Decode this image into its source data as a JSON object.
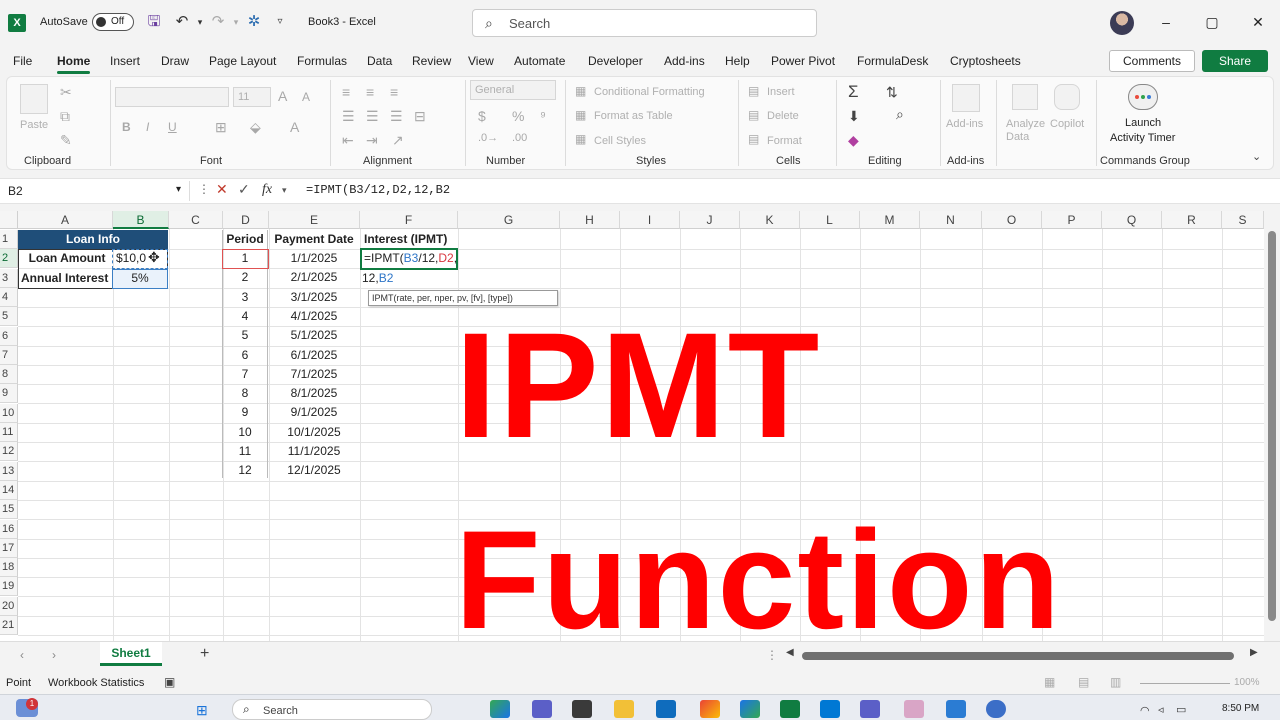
{
  "titlebar": {
    "autosave_label": "AutoSave",
    "toggle_state": "Off",
    "doc_title": "Book3 - Excel",
    "search_placeholder": "Search",
    "minimize": "–",
    "restore": "▢",
    "close": "✕"
  },
  "menu": {
    "items": [
      "File",
      "Home",
      "Insert",
      "Draw",
      "Page Layout",
      "Formulas",
      "Data",
      "Review",
      "View",
      "Automate",
      "Developer",
      "Add-ins",
      "Help",
      "Power Pivot",
      "FormulaDesk",
      "Cryptosheets"
    ],
    "active": "Home",
    "comments_label": "Comments",
    "share_label": "Share"
  },
  "ribbon": {
    "groups": [
      "Clipboard",
      "Font",
      "Alignment",
      "Number",
      "Styles",
      "Cells",
      "Editing",
      "Add-ins",
      "Commands Group"
    ],
    "paste_label": "Paste",
    "font_size": "11",
    "number_format": "General",
    "conditional_formatting": "Conditional Formatting",
    "format_as_table": "Format as Table",
    "cell_styles": "Cell Styles",
    "insert": "Insert",
    "delete": "Delete",
    "format": "Format",
    "add_ins": "Add-ins",
    "analyze_data": "Analyze Data",
    "copilot": "Copilot",
    "launch_timer_1": "Launch",
    "launch_timer_2": "Activity Timer"
  },
  "formula_bar": {
    "name_box": "B2",
    "fx_label": "fx",
    "formula": "=IPMT(B3/12,D2,12,B2"
  },
  "columns": [
    "A",
    "B",
    "C",
    "D",
    "E",
    "F",
    "G",
    "H",
    "I",
    "J",
    "K",
    "L",
    "M",
    "N",
    "O",
    "P",
    "Q",
    "R",
    "S"
  ],
  "rows": [
    "1",
    "2",
    "3",
    "4",
    "5",
    "6",
    "7",
    "8",
    "9",
    "10",
    "11",
    "12",
    "13",
    "14",
    "15",
    "16",
    "17",
    "18",
    "19",
    "20",
    "21"
  ],
  "sheet": {
    "loan_info_header": "Loan Info",
    "loan_amount_label": "Loan Amount",
    "loan_amount_value": "$10,0",
    "annual_interest_label": "Annual Interest",
    "annual_interest_value": "5%",
    "period_header": "Period",
    "payment_date_header": "Payment Date",
    "interest_header": "Interest (IPMT)",
    "periods": [
      "1",
      "2",
      "3",
      "4",
      "5",
      "6",
      "7",
      "8",
      "9",
      "10",
      "11",
      "12"
    ],
    "dates": [
      "1/1/2025",
      "2/1/2025",
      "3/1/2025",
      "4/1/2025",
      "5/1/2025",
      "6/1/2025",
      "7/1/2025",
      "8/1/2025",
      "9/1/2025",
      "10/1/2025",
      "11/1/2025",
      "12/1/2025"
    ],
    "edit_formula_part1": "=IPMT(",
    "edit_formula_ref1": "B3",
    "edit_formula_part2": "/12,",
    "edit_formula_ref2": "D2",
    "edit_formula_part3": ",",
    "edit_line2_prefix": "12,",
    "edit_line2_ref": "B2",
    "tooltip": "IPMT(rate, per, nper, pv, [fv], [type])"
  },
  "overlay": {
    "line1": "IPMT",
    "line2": "Function",
    "color": "#ff0000"
  },
  "tabs": {
    "sheet1": "Sheet1",
    "add": "+"
  },
  "status": {
    "mode": "Point",
    "workbook_statistics": "Workbook Statistics",
    "zoom": "100%"
  },
  "taskbar": {
    "search_placeholder": "Search",
    "time": "8:50 PM",
    "notification_count": "1"
  }
}
